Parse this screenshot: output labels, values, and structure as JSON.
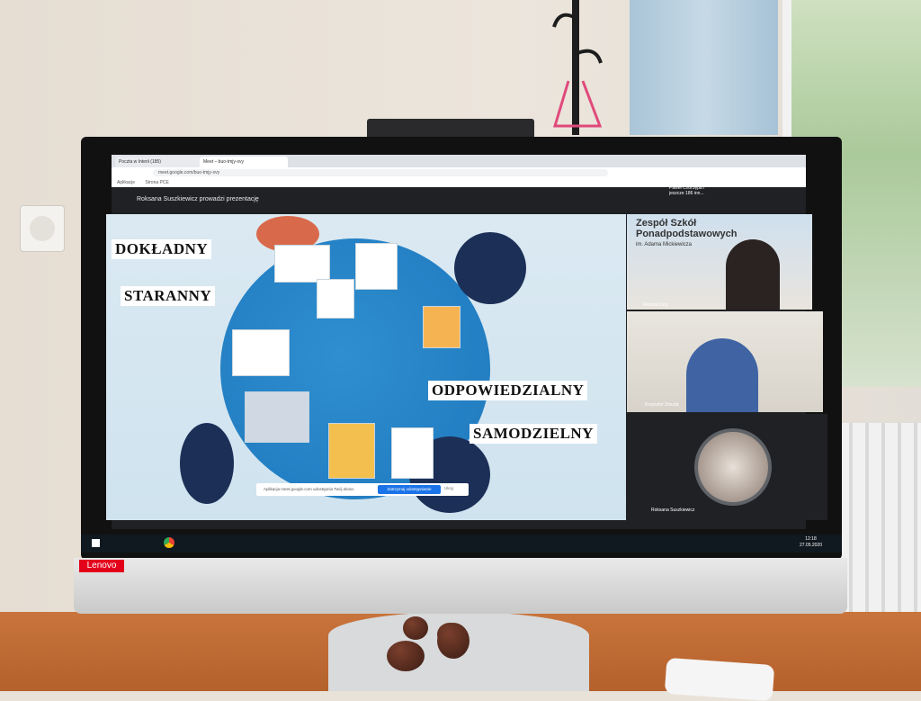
{
  "browser": {
    "tabs": [
      "Poczta w Interii (185)",
      "Meet – buo-tmjy-xvy"
    ],
    "url": "meet.google.com/buo-tmjy-xvy",
    "bookmarks": [
      "Aplikacje",
      "Strona PCE"
    ]
  },
  "meet": {
    "presenter_text": "Roksana Suszkiewicz prowadzi prezentację",
    "participants_text": "Paweł Chorzępa i jeszcze 186 inn...",
    "share_notice": "Aplikacja meet.google.com udostępnia Twój ekran.",
    "share_stop_button": "Zatrzymaj udostępnianie",
    "share_hide_button": "Ukryj",
    "tiles": [
      {
        "name": "Renata Czuj"
      },
      {
        "name": "Krzysztof Żmuda"
      },
      {
        "name": "Roksana Suszkiewicz"
      }
    ],
    "school_sign": [
      "Zespół Szkół",
      "Ponadpodstawowych",
      "im. Adama Mickiewicza"
    ]
  },
  "slide": {
    "words": [
      "DOKŁADNY",
      "STARANNY",
      "ODPOWIEDZIALNY",
      "SAMODZIELNY"
    ]
  },
  "taskbar": {
    "time": "12:18",
    "date": "27.05.2020"
  },
  "monitor": {
    "brand": "Lenovo"
  },
  "colors": {
    "accent": "#1a73e8",
    "table_top": "#1f78bd",
    "meet_bg": "#202124"
  }
}
